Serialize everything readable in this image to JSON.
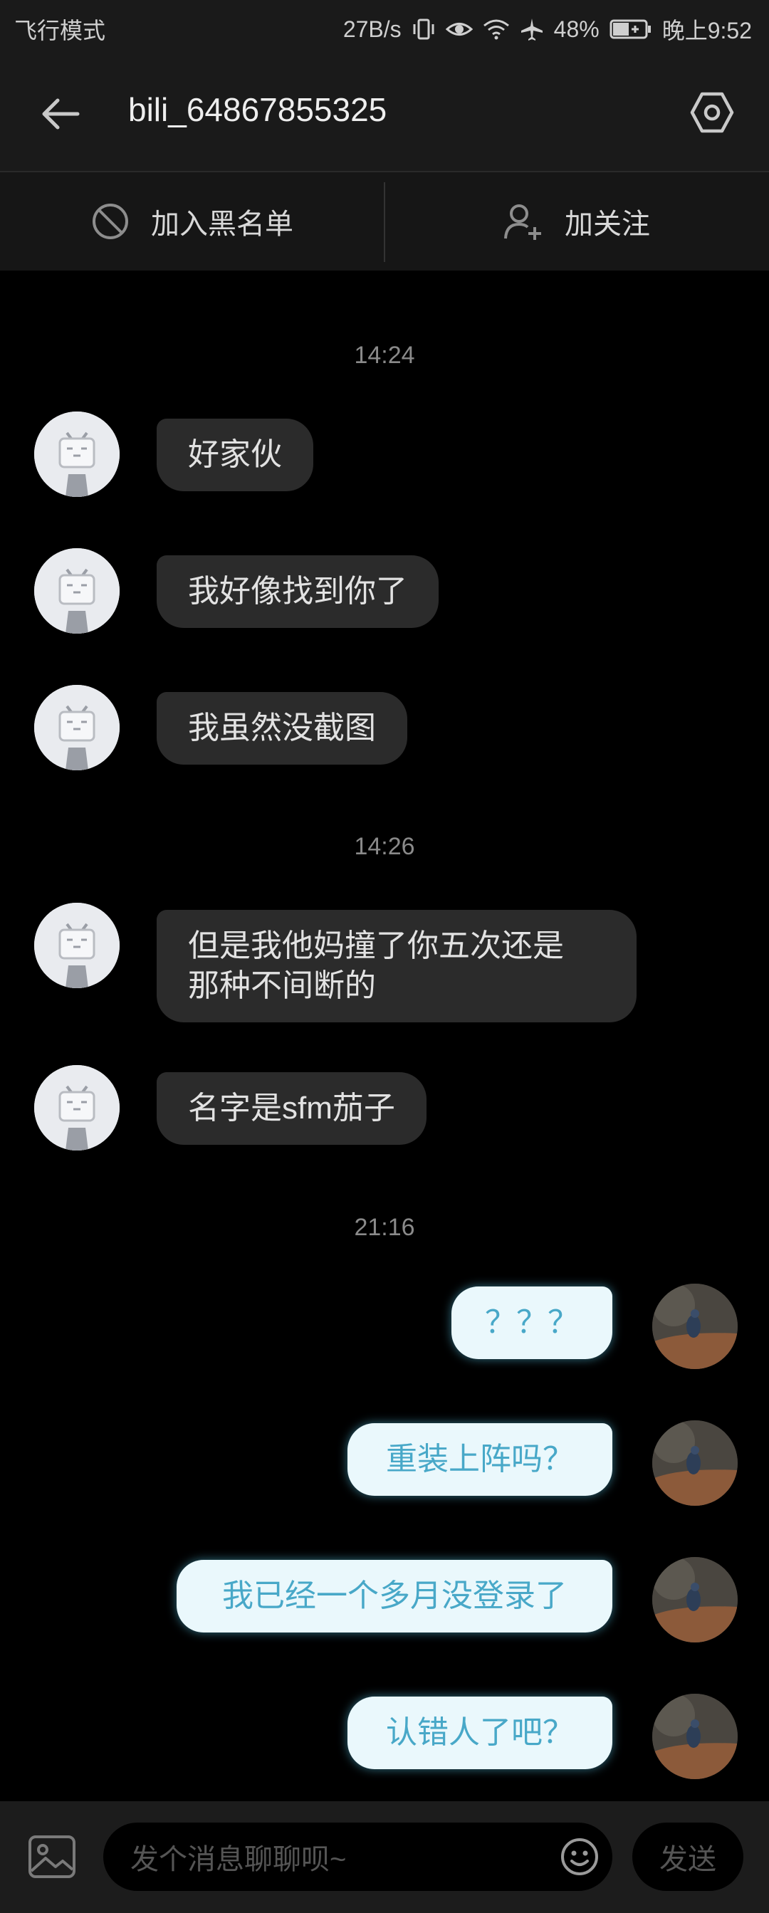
{
  "status_bar": {
    "left_text": "飞行模式",
    "speed": "27B/s",
    "battery_percent": "48%",
    "time": "晚上9:52"
  },
  "header": {
    "title": "bili_64867855325"
  },
  "actions": {
    "blacklist": "加入黑名单",
    "follow": "加关注"
  },
  "chat": {
    "timestamps": [
      "14:24",
      "14:26",
      "21:16"
    ],
    "messages": [
      {
        "from": "other",
        "text": "好家伙"
      },
      {
        "from": "other",
        "text": "我好像找到你了"
      },
      {
        "from": "other",
        "text": "我虽然没截图"
      },
      {
        "from": "other",
        "text_line1": "但是我他妈撞了你五次还是",
        "text_line2": "那种不间断的"
      },
      {
        "from": "other",
        "text": "名字是sfm茄子"
      },
      {
        "from": "self",
        "text": "？？？"
      },
      {
        "from": "self",
        "text": "重装上阵吗？"
      },
      {
        "from": "self",
        "text": "我已经一个多月没登录了"
      },
      {
        "from": "self",
        "text": "认错人了吧？"
      }
    ]
  },
  "input_bar": {
    "placeholder": "发个消息聊聊呗~",
    "send_label": "发送"
  },
  "colors": {
    "self_bubble_bg": "#eaf8fc",
    "self_bubble_text": "#48a8c8",
    "other_bubble_bg": "#2b2b2b"
  }
}
